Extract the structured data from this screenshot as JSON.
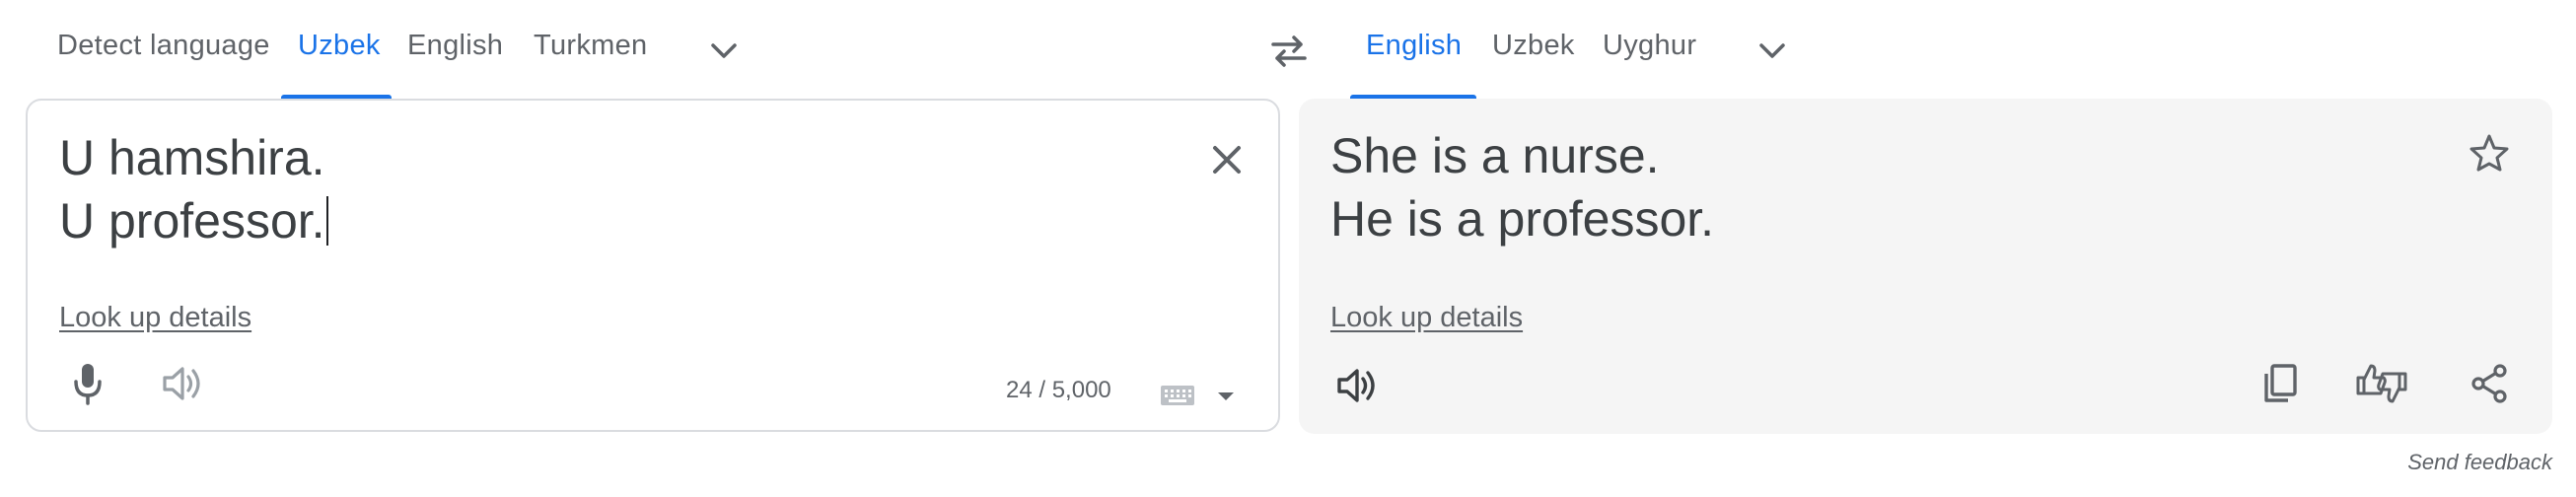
{
  "source_languages": {
    "tabs": [
      {
        "label": "Detect language",
        "active": false
      },
      {
        "label": "Uzbek",
        "active": true
      },
      {
        "label": "English",
        "active": false
      },
      {
        "label": "Turkmen",
        "active": false
      }
    ],
    "more_icon": "chevron-down-icon"
  },
  "swap_icon": "swap-arrows-icon",
  "target_languages": {
    "tabs": [
      {
        "label": "English",
        "active": true
      },
      {
        "label": "Uzbek",
        "active": false
      },
      {
        "label": "Uyghur",
        "active": false
      }
    ],
    "more_icon": "chevron-down-icon"
  },
  "source": {
    "lines": [
      "U hamshira.",
      "U professor."
    ],
    "look_up": "Look up details",
    "char_count": "24 / 5,000",
    "icons": [
      "close-icon",
      "microphone-icon",
      "speaker-icon",
      "keyboard-icon",
      "caret-down-icon"
    ]
  },
  "target": {
    "lines": [
      "She is a nurse.",
      "He is a professor."
    ],
    "look_up": "Look up details",
    "icons": [
      "star-icon",
      "speaker-icon",
      "copy-icon",
      "rate-translation-icon",
      "share-icon"
    ]
  },
  "send_feedback": "Send feedback",
  "colors": {
    "accent": "#1a73e8",
    "text": "#3c4043",
    "muted": "#5f6368",
    "target_bg": "#f5f5f5",
    "border": "#dadce0"
  }
}
